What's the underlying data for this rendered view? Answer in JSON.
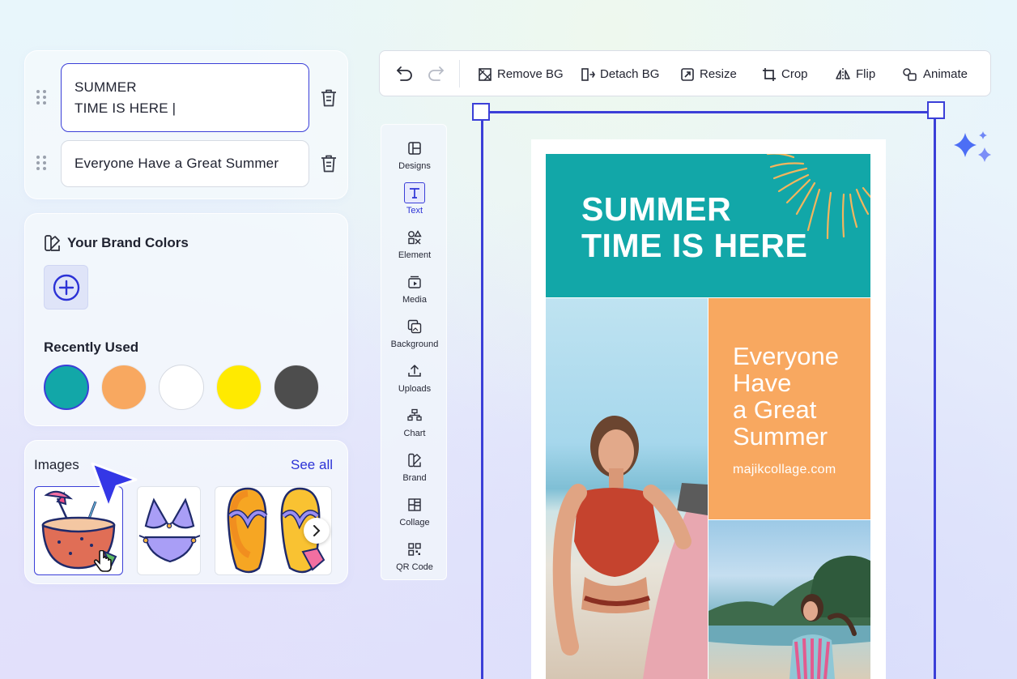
{
  "text_panel": {
    "fields": [
      {
        "value": "SUMMER\nTIME IS HERE |"
      },
      {
        "value": "Everyone Have a Great Summer"
      }
    ]
  },
  "brand_panel": {
    "title": "Your Brand Colors",
    "recent_title": "Recently Used",
    "recent_colors": [
      "#12a7a8",
      "#f8a860",
      "#ffffff",
      "#ffea00",
      "#4d4d4d"
    ]
  },
  "images_panel": {
    "title": "Images",
    "see_all": "See all"
  },
  "toolbar": {
    "remove_bg": "Remove BG",
    "detach_bg": "Detach BG",
    "resize": "Resize",
    "crop": "Crop",
    "flip": "Flip",
    "animate": "Animate"
  },
  "sidenav": {
    "items": [
      {
        "label": "Designs"
      },
      {
        "label": "Text"
      },
      {
        "label": "Element"
      },
      {
        "label": "Media"
      },
      {
        "label": "Background"
      },
      {
        "label": "Uploads"
      },
      {
        "label": "Chart"
      },
      {
        "label": "Brand"
      },
      {
        "label": "Collage"
      },
      {
        "label": "QR Code"
      }
    ]
  },
  "poster": {
    "heading": "SUMMER\nTIME IS HERE",
    "subheading": "Everyone\nHave\na Great\nSummer",
    "url": "majikcollage.com"
  },
  "colors": {
    "accent": "#3b3fd8",
    "teal": "#12a7a8",
    "orange": "#f8a860"
  }
}
